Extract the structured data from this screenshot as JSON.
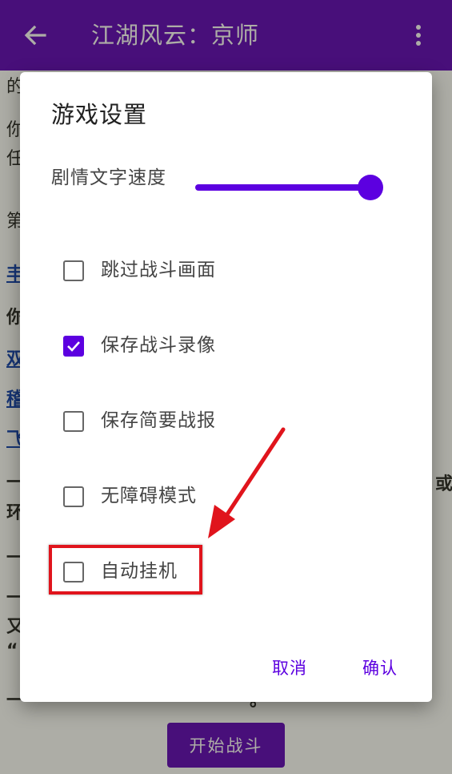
{
  "appbar": {
    "title": "江湖风云：京师",
    "back_icon": "arrow-left-icon",
    "more_icon": "more-vert-icon"
  },
  "background_fragments": [
    {
      "text": "的"
    },
    {
      "text": "你"
    },
    {
      "text": "任"
    },
    {
      "text": "第"
    },
    {
      "text": "丰"
    },
    {
      "text": "你"
    },
    {
      "text": "双"
    },
    {
      "text": "稽"
    },
    {
      "text": "飞"
    },
    {
      "text": "一"
    },
    {
      "text": "环"
    },
    {
      "text": "一"
    },
    {
      "text": "一"
    },
    {
      "text": "又"
    },
    {
      "text": "“"
    },
    {
      "text": "一"
    },
    {
      "text": "或"
    },
    {
      "text": "。"
    }
  ],
  "bottom": {
    "start_label": "开始战斗"
  },
  "dialog": {
    "title": "游戏设置",
    "speed_label": "剧情文字速度",
    "speed_value_percent": 100,
    "options": [
      {
        "label": "跳过战斗画面",
        "checked": false
      },
      {
        "label": "保存战斗录像",
        "checked": true
      },
      {
        "label": "保存简要战报",
        "checked": false
      },
      {
        "label": "无障碍模式",
        "checked": false
      },
      {
        "label": "自动挂机",
        "checked": false
      }
    ],
    "cancel_label": "取消",
    "confirm_label": "确认"
  },
  "colors": {
    "primary": "#5c00b8",
    "accent": "#5c00e0",
    "annotation": "#e0141c"
  }
}
